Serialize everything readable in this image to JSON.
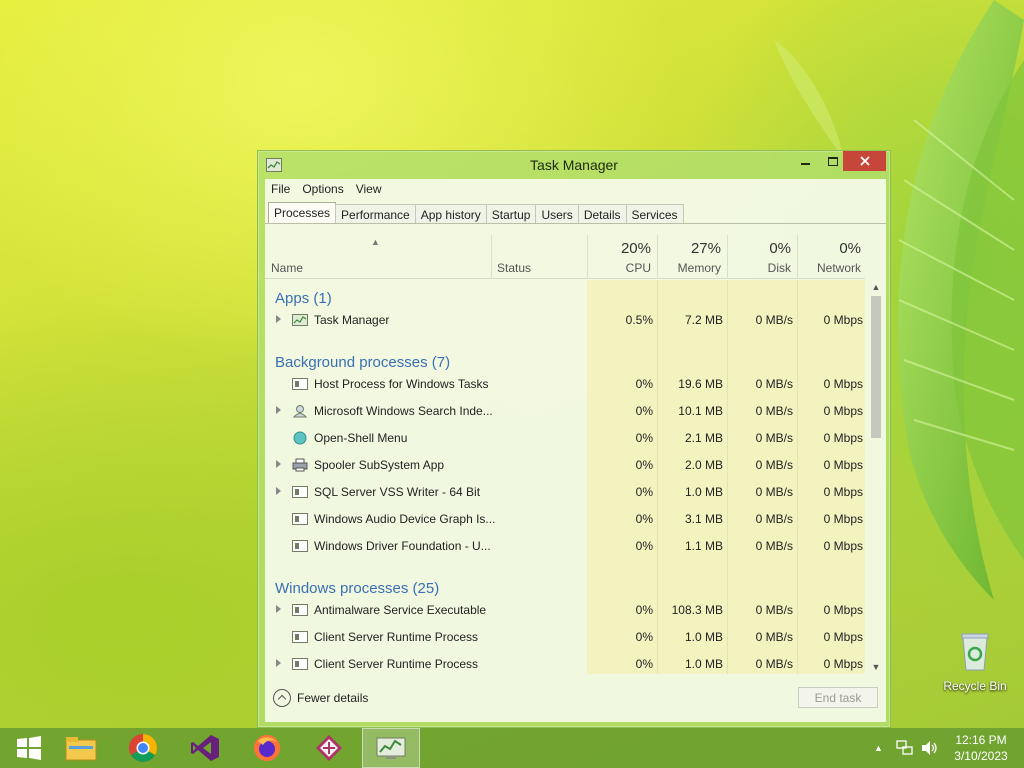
{
  "window": {
    "title": "Task Manager",
    "menu": [
      "File",
      "Options",
      "View"
    ],
    "tabs": [
      "Processes",
      "Performance",
      "App history",
      "Startup",
      "Users",
      "Details",
      "Services"
    ],
    "active_tab": "Processes"
  },
  "columns": {
    "name": "Name",
    "status": "Status",
    "cpu": {
      "pct": "20%",
      "label": "CPU"
    },
    "memory": {
      "pct": "27%",
      "label": "Memory"
    },
    "disk": {
      "pct": "0%",
      "label": "Disk"
    },
    "network": {
      "pct": "0%",
      "label": "Network"
    }
  },
  "groups": {
    "apps": "Apps (1)",
    "background": "Background processes (7)",
    "windows": "Windows processes (25)"
  },
  "processes": [
    {
      "name": "Task Manager",
      "cpu": "0.5%",
      "mem": "7.2 MB",
      "disk": "0 MB/s",
      "net": "0 Mbps",
      "expandable": true,
      "icon": "task-manager-icon"
    },
    {
      "name": "Host Process for Windows Tasks",
      "cpu": "0%",
      "mem": "19.6 MB",
      "disk": "0 MB/s",
      "net": "0 Mbps",
      "expandable": false,
      "icon": "window-process-icon"
    },
    {
      "name": "Microsoft Windows Search Inde...",
      "cpu": "0%",
      "mem": "10.1 MB",
      "disk": "0 MB/s",
      "net": "0 Mbps",
      "expandable": true,
      "icon": "search-indexer-icon"
    },
    {
      "name": "Open-Shell Menu",
      "cpu": "0%",
      "mem": "2.1 MB",
      "disk": "0 MB/s",
      "net": "0 Mbps",
      "expandable": false,
      "icon": "shell-icon"
    },
    {
      "name": "Spooler SubSystem App",
      "cpu": "0%",
      "mem": "2.0 MB",
      "disk": "0 MB/s",
      "net": "0 Mbps",
      "expandable": true,
      "icon": "printer-icon"
    },
    {
      "name": "SQL Server VSS Writer - 64 Bit",
      "cpu": "0%",
      "mem": "1.0 MB",
      "disk": "0 MB/s",
      "net": "0 Mbps",
      "expandable": true,
      "icon": "window-process-icon"
    },
    {
      "name": "Windows Audio Device Graph Is...",
      "cpu": "0%",
      "mem": "3.1 MB",
      "disk": "0 MB/s",
      "net": "0 Mbps",
      "expandable": false,
      "icon": "window-process-icon"
    },
    {
      "name": "Windows Driver Foundation - U...",
      "cpu": "0%",
      "mem": "1.1 MB",
      "disk": "0 MB/s",
      "net": "0 Mbps",
      "expandable": false,
      "icon": "window-process-icon"
    },
    {
      "name": "Antimalware Service Executable",
      "cpu": "0%",
      "mem": "108.3 MB",
      "disk": "0 MB/s",
      "net": "0 Mbps",
      "expandable": true,
      "icon": "window-process-icon"
    },
    {
      "name": "Client Server Runtime Process",
      "cpu": "0%",
      "mem": "1.0 MB",
      "disk": "0 MB/s",
      "net": "0 Mbps",
      "expandable": false,
      "icon": "window-process-icon"
    },
    {
      "name": "Client Server Runtime Process",
      "cpu": "0%",
      "mem": "1.0 MB",
      "disk": "0 MB/s",
      "net": "0 Mbps",
      "expandable": true,
      "icon": "window-process-icon"
    }
  ],
  "footer": {
    "fewer_details": "Fewer details",
    "end_task": "End task"
  },
  "desktop": {
    "recycle_bin": "Recycle Bin"
  },
  "taskbar": {
    "apps": [
      "start-icon",
      "file-explorer-icon",
      "chrome-icon",
      "visual-studio-icon",
      "firefox-icon",
      "app-icon",
      "task-manager-icon"
    ],
    "time": "12:16 PM",
    "date": "3/10/2023"
  },
  "colors": {
    "group_text": "#3a6fb5",
    "heat_yellow": "#f4efa6",
    "close_button": "#c7463a"
  }
}
